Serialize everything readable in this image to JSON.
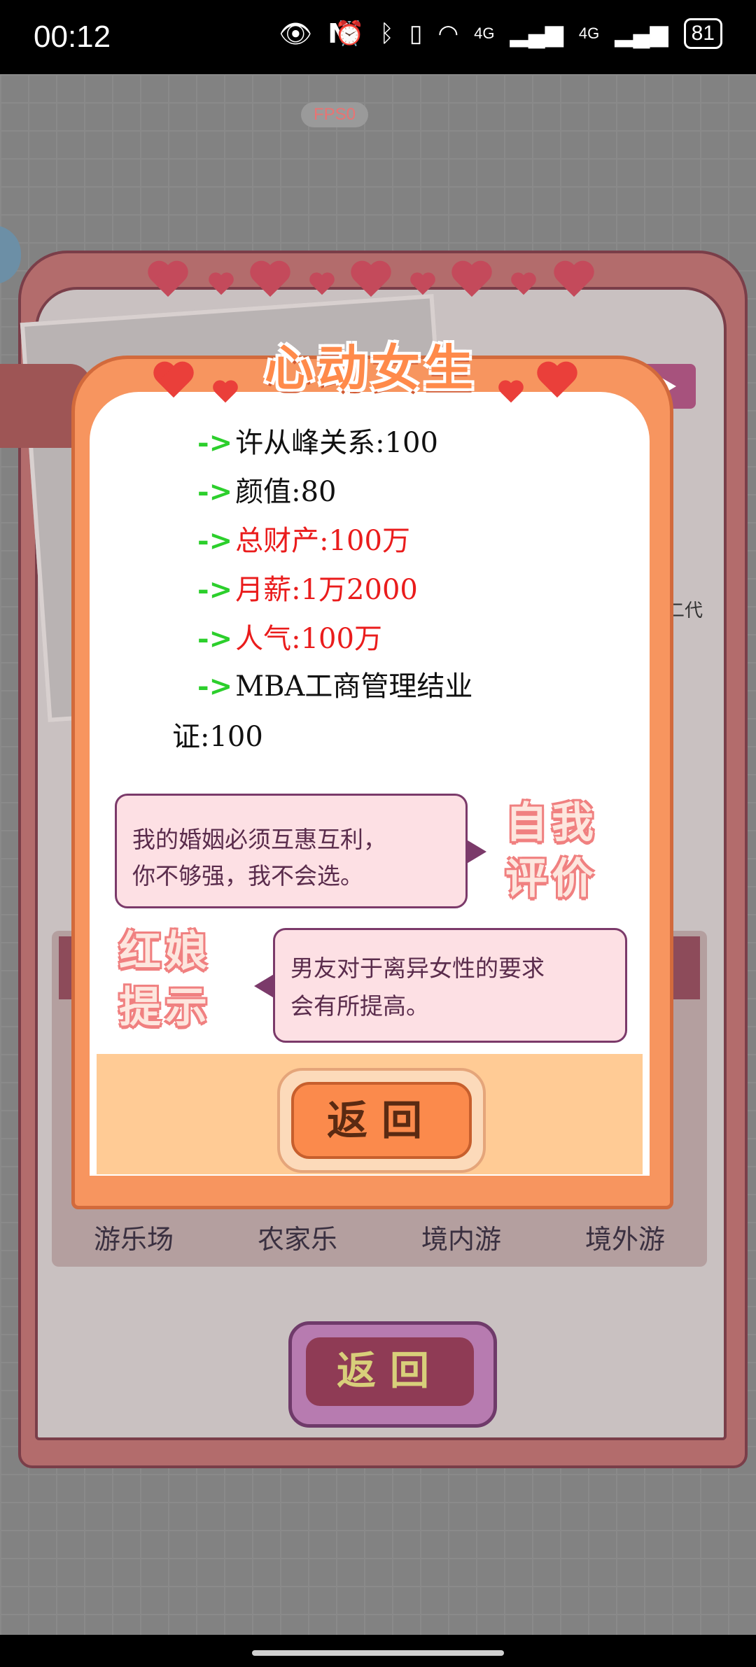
{
  "status_bar": {
    "time": "00:12",
    "network_labels": [
      "4G",
      "4G"
    ],
    "battery": "81"
  },
  "fps": "FPS0",
  "background_panel": {
    "side_text": "二代",
    "options": [
      "游乐场",
      "农家乐",
      "境内游",
      "境外游"
    ],
    "return_label": "返回"
  },
  "modal": {
    "title": "心动女生",
    "stats": [
      {
        "arrow": "->",
        "text": "许从峰关系:100",
        "color": "#111"
      },
      {
        "arrow": "->",
        "text": "颜值:80",
        "color": "#111"
      },
      {
        "arrow": "->",
        "text": "总财产:100万",
        "color": "#ea1c1c"
      },
      {
        "arrow": "->",
        "text": "月薪:1万2000",
        "color": "#ea1c1c"
      },
      {
        "arrow": "->",
        "text": "人气:100万",
        "color": "#ea1c1c"
      },
      {
        "arrow": "->",
        "text": "MBA工商管理结业",
        "color": "#111"
      }
    ],
    "stat_continuation": "证:100",
    "self_evaluation": {
      "label_line1": "自我",
      "label_line2": "评价",
      "line1": "我的婚姻必须互惠互利，",
      "line2": "你不够强，我不会选。"
    },
    "matchmaker_hint": {
      "label_line1": "红娘",
      "label_line2": "提示",
      "line1": "男友对于离异女性的要求",
      "line2": "会有所提高。"
    },
    "return_label": "返回"
  }
}
